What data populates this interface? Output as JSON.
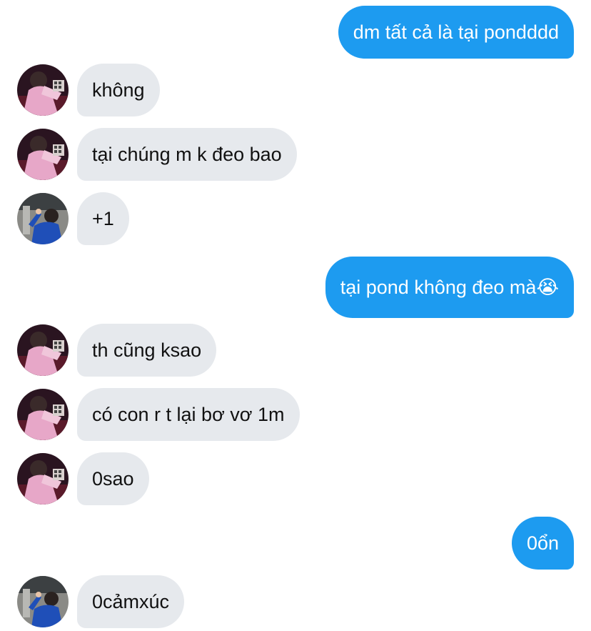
{
  "conversation": {
    "messages": [
      {
        "side": "out",
        "text": "dm tất cả là tại pondddd"
      },
      {
        "side": "in",
        "avatar": "pink-photo-avatar",
        "text": "không"
      },
      {
        "side": "in",
        "avatar": "pink-photo-avatar",
        "text": "tại chúng m k đeo bao"
      },
      {
        "side": "in",
        "avatar": "blue-photo-avatar",
        "text": "+1"
      },
      {
        "side": "out",
        "text": "tại pond không đeo mà😭"
      },
      {
        "side": "in",
        "avatar": "pink-photo-avatar",
        "text": "th cũng ksao"
      },
      {
        "side": "in",
        "avatar": "pink-photo-avatar",
        "text": "có con r t lại bơ vơ 1m"
      },
      {
        "side": "in",
        "avatar": "pink-photo-avatar",
        "text": "0sao"
      },
      {
        "side": "out",
        "text": "0ổn"
      },
      {
        "side": "in",
        "avatar": "blue-photo-avatar",
        "text": "0cảmxúc"
      }
    ]
  },
  "colors": {
    "outgoing_bubble": "#1d9bf0",
    "incoming_bubble": "#e6e9ed"
  }
}
